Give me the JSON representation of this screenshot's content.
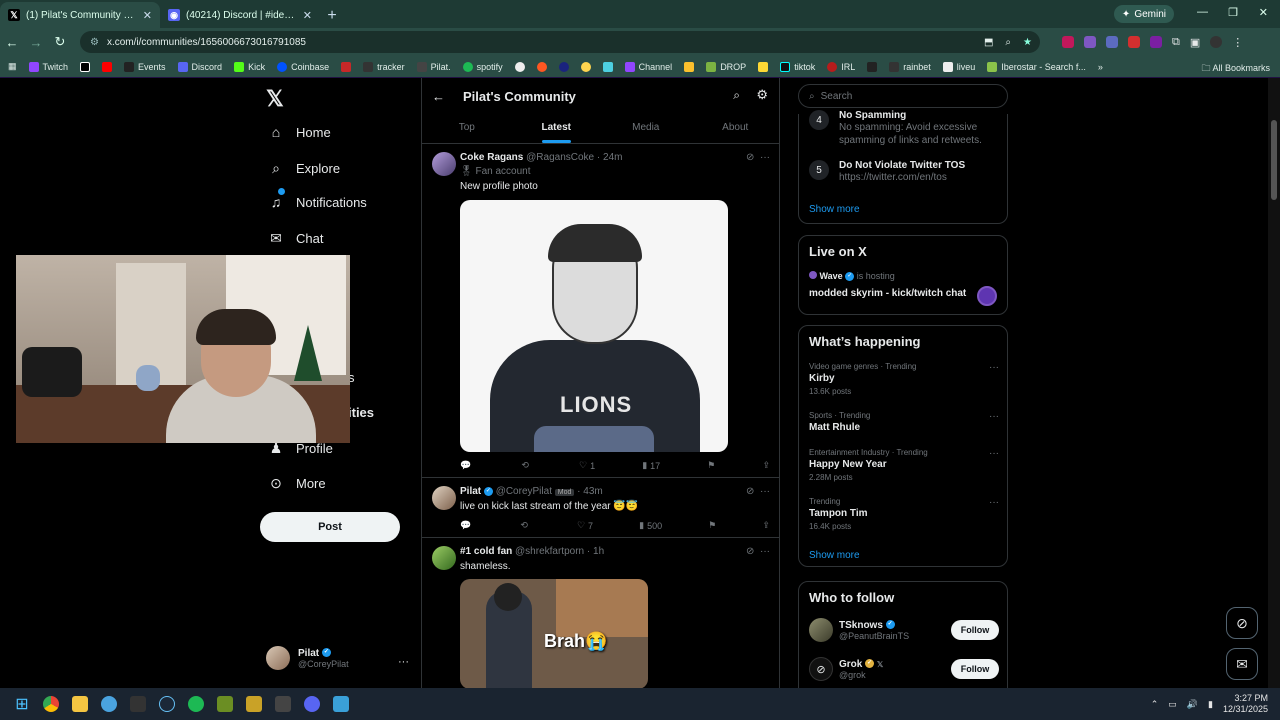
{
  "browser": {
    "tabs": [
      {
        "title": "(1) Pilat's Community Community",
        "active": true
      },
      {
        "title": "(40214) Discord | #ideas | Pilat's",
        "active": false
      }
    ],
    "gemini_label": "Gemini",
    "url": "x.com/i/communities/1656006673016791085",
    "bookmarks": [
      "Twitch",
      "Events",
      "Discord",
      "Kick",
      "Coinbase",
      "tracker",
      "Pilat.",
      "spotify",
      "Channel",
      "DROP",
      "tiktok",
      "IRL",
      "rainbet",
      "liveu",
      "Iberostar - Search f..."
    ],
    "all_bookmarks": "All Bookmarks"
  },
  "nav": {
    "items": [
      "Home",
      "Explore",
      "Notifications",
      "Chat",
      "s",
      "ities",
      "Profile",
      "More"
    ],
    "post_button": "Post",
    "account": {
      "name": "Pilat",
      "handle": "@CoreyPilat"
    }
  },
  "community": {
    "title": "Pilat's Community",
    "tabs": [
      "Top",
      "Latest",
      "Media",
      "About"
    ],
    "active_tab": "Latest",
    "posts": [
      {
        "name": "Coke Ragans",
        "handle": "@RagansCoke",
        "time": "24m",
        "badge": "Fan account",
        "text": "New profile photo",
        "image_text": "LIONS",
        "replies": "",
        "reposts": "",
        "likes": "1",
        "views": "17"
      },
      {
        "name": "Pilat",
        "handle": "@CoreyPilat",
        "mod": "Mod",
        "time": "43m",
        "text": "live on kick last stream of the year 😇😇",
        "replies": "",
        "reposts": "",
        "likes": "7",
        "views": "500"
      },
      {
        "name": "#1 cold fan",
        "handle": "@shrekfartporn",
        "time": "1h",
        "text": "shameless.",
        "image_text": "Brah😭"
      }
    ]
  },
  "sidebar": {
    "search_placeholder": "Search",
    "rules": [
      {
        "num": "4",
        "title": "No Spamming",
        "desc": "No spamming: Avoid excessive spamming of links and retweets."
      },
      {
        "num": "5",
        "title": "Do Not Violate Twitter TOS",
        "desc": "https://twitter.com/en/tos"
      }
    ],
    "show_more": "Show more",
    "live": {
      "title": "Live on X",
      "host": "Wave",
      "hosting_label": "is hosting",
      "stream_title": "modded skyrim - kick/twitch chat"
    },
    "happening": {
      "title": "What’s happening",
      "trends": [
        {
          "category": "Video game genres · Trending",
          "name": "Kirby",
          "posts": "13.6K posts"
        },
        {
          "category": "Sports · Trending",
          "name": "Matt Rhule",
          "posts": ""
        },
        {
          "category": "Entertainment Industry · Trending",
          "name": "Happy New Year",
          "posts": "2.28M posts"
        },
        {
          "category": "Trending",
          "name": "Tampon Tim",
          "posts": "16.4K posts"
        }
      ],
      "show_more": "Show more"
    },
    "who_to_follow": {
      "title": "Who to follow",
      "accounts": [
        {
          "name": "TSknows",
          "handle": "@PeanutBrainTS",
          "button": "Follow"
        },
        {
          "name": "Grok",
          "handle": "@grok",
          "button": "Follow"
        }
      ]
    }
  },
  "taskbar": {
    "time": "3:27 PM",
    "date": "12/31/2025"
  },
  "colors": {
    "accent": "#1d9bf0",
    "browser_frame": "#2a4c45"
  }
}
